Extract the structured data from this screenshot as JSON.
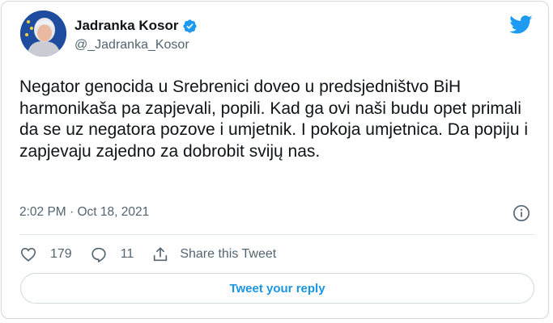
{
  "author": {
    "name": "Jadranka Kosor",
    "handle": "@_Jadranka_Kosor"
  },
  "tweet": {
    "text": "Negator genocida u Srebrenici doveo u predsjedništvo BiH harmonikaša pa zapjevali, popili. Kad ga ovi naši budu opet primali da se uz negatora pozove i umjetnik. I pokoja umjetnica. Da popiju i zapjevaju zajedno za dobrobit svijų nas.",
    "timestamp": "2:02 PM · Oct 18, 2021"
  },
  "actions": {
    "likes": "179",
    "replies": "11",
    "share_label": "Share this Tweet"
  },
  "reply_button": {
    "label": "Tweet your reply"
  },
  "icons": {
    "verified": "verified-badge-icon",
    "brand": "twitter-bird-icon",
    "info": "info-icon",
    "like": "heart-icon",
    "reply": "speech-bubble-icon",
    "share": "share-upload-icon"
  },
  "colors": {
    "accent": "#1d9bf0",
    "reply_text": "#1b95e0",
    "secondary_text": "#536471",
    "border": "#cfd9de"
  }
}
